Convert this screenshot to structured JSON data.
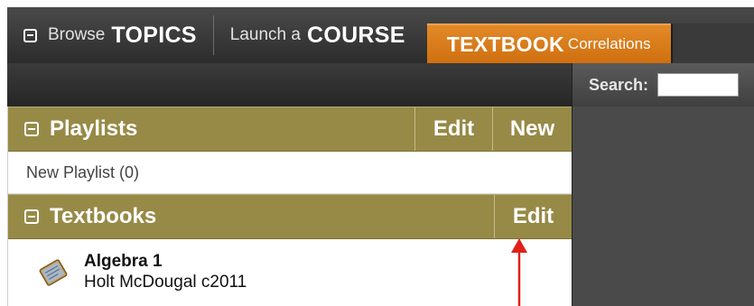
{
  "nav": {
    "browse": {
      "small": "Browse",
      "big": "TOPICS"
    },
    "launch": {
      "small": "Launch a",
      "big": "COURSE"
    },
    "textbook": {
      "big": "TEXTBOOK",
      "small": "Correlations"
    }
  },
  "search": {
    "label": "Search:",
    "value": ""
  },
  "playlists": {
    "title": "Playlists",
    "edit_label": "Edit",
    "new_label": "New",
    "items": [
      "New Playlist (0)"
    ]
  },
  "textbooks": {
    "title": "Textbooks",
    "edit_label": "Edit",
    "items": [
      {
        "title": "Algebra 1",
        "publisher": "Holt McDougal c2011"
      }
    ]
  },
  "colors": {
    "accent_orange": "#d97a1a",
    "section_olive": "#978a47",
    "dark_bar": "#2c2c2c",
    "annotation_red": "#e0201a"
  }
}
